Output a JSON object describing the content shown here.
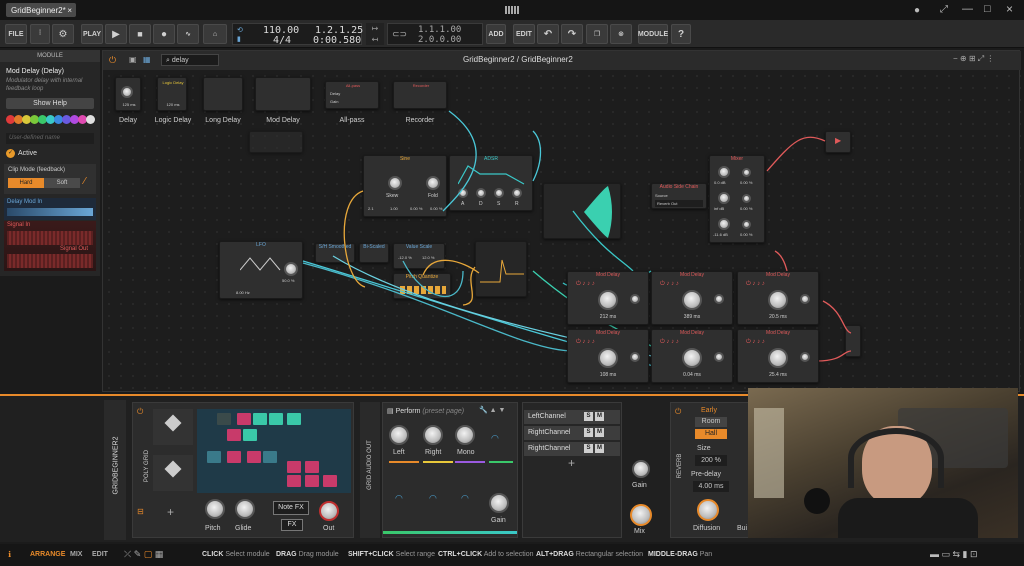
{
  "window": {
    "tab_title": "GridBeginner2*"
  },
  "toolbar": {
    "file": "FILE",
    "play": "PLAY",
    "tempo": "110.00",
    "time_sig": "4/4",
    "position": "1.2.1.25",
    "time": "0:00.580",
    "loop_start": "1.1.1.00",
    "loop_len": "2.0.0.00",
    "add": "ADD",
    "edit": "EDIT",
    "module": "MODULE"
  },
  "inspector": {
    "header": "MODULE",
    "title": "Mod Delay (Delay)",
    "description": "Modulator delay with internal feedback loop",
    "show_help": "Show Help",
    "name_placeholder": "User-defined name",
    "active": "Active",
    "clip_mode": "Clip Mode (feedback)",
    "hard": "Hard",
    "soft": "Soft",
    "delay_mod_in": "Delay Mod In",
    "signal_in": "Signal In",
    "signal_out": "Signal Out",
    "colors": [
      "#e03a3a",
      "#e07a2a",
      "#d8c83a",
      "#7ac83a",
      "#3ac86a",
      "#3ac8c8",
      "#3a8ae0",
      "#6a5ae0",
      "#b04ae0",
      "#e04ab0",
      "#e0e0e0"
    ]
  },
  "grid": {
    "breadcrumb": "GridBeginner2 / GridBeginner2",
    "search": "delay",
    "browser": [
      {
        "name": "Delay",
        "val": "125 ms"
      },
      {
        "name": "Logic Delay",
        "val": "120 ms"
      },
      {
        "name": "Long Delay",
        "val": ""
      },
      {
        "name": "Mod Delay",
        "val": ""
      },
      {
        "name": "All-pass",
        "val": ""
      },
      {
        "name": "Recorder",
        "val": ""
      }
    ],
    "allpass": {
      "title": "All-pass",
      "delay": "Delay",
      "gain": "Gain"
    },
    "recorder": "Recorder",
    "logic_title": "Logic Delay",
    "lfo": {
      "title": "LFO",
      "rate": "8.00 Hz",
      "amt": "50.0 %"
    },
    "sh": "S/H Smoothed",
    "rand": "Bi-Scaled",
    "value_scale": "Value Scale",
    "vs1": "-12.0 %",
    "vs2": "12.0 %",
    "pitch_quant": "Pitch Quantize",
    "osc": {
      "title": "Sine",
      "k1": "Skew",
      "k2": "Fold",
      "v1": "2.1",
      "v2": "0.00 %",
      "v3": "0.00 %",
      "v4": "1.00"
    },
    "adsr": {
      "title": "ADSR",
      "a": "A",
      "d": "D",
      "s": "S",
      "r": "R"
    },
    "audio_out": {
      "title": "Audio Side Chain",
      "source": "Source",
      "src_val": "Reverb Out"
    },
    "mixer": {
      "title": "Mixer",
      "v": [
        "0.0 dB",
        "0.00 %",
        "inf dB",
        "0.00 %",
        "-11.6 dB",
        "0.00 %"
      ]
    },
    "delays": [
      {
        "t": "Mod Delay",
        "v": "212 ms"
      },
      {
        "t": "Mod Delay",
        "v": "389 ms"
      },
      {
        "t": "Mod Delay",
        "v": "20.5 ms"
      },
      {
        "t": "Mod Delay",
        "v": "108 ms"
      },
      {
        "t": "Mod Delay",
        "v": "0.04 ms"
      },
      {
        "t": "Mod Delay",
        "v": "25.4 ms"
      }
    ]
  },
  "device": {
    "track": "GRIDBEGINNER2",
    "poly": "POLY GRID",
    "pitch": "Pitch",
    "glide": "Glide",
    "note_fx": "Note FX",
    "fx": "FX",
    "out": "Out",
    "audio_out": "GRID AUDIO OUT",
    "perform": "Perform",
    "preset": "(preset page)",
    "knobs": [
      "Left",
      "Right",
      "Mono"
    ],
    "gain": "Gain",
    "channels": [
      "LeftChannel",
      "RightChannel",
      "RightChannel"
    ],
    "gain2": "Gain",
    "mix": "Mix",
    "reverb": "REVERB",
    "early": "Early",
    "room": "Room",
    "hall": "Hall",
    "size": "Size",
    "size_val": "200 %",
    "predelay": "Pre-delay",
    "predelay_val": "4.00 ms",
    "diffusion": "Diffusion",
    "build": "Bui"
  },
  "status": {
    "arrange": "ARRANGE",
    "mix": "MIX",
    "edit": "EDIT",
    "hints": [
      {
        "k": "CLICK",
        "v": "Select module"
      },
      {
        "k": "DRAG",
        "v": "Drag module"
      },
      {
        "k": "SHIFT+CLICK",
        "v": "Select range"
      },
      {
        "k": "CTRL+CLICK",
        "v": "Add to selection"
      },
      {
        "k": "ALT+DRAG",
        "v": "Rectangular selection"
      },
      {
        "k": "MIDDLE-DRAG",
        "v": "Pan"
      }
    ]
  }
}
